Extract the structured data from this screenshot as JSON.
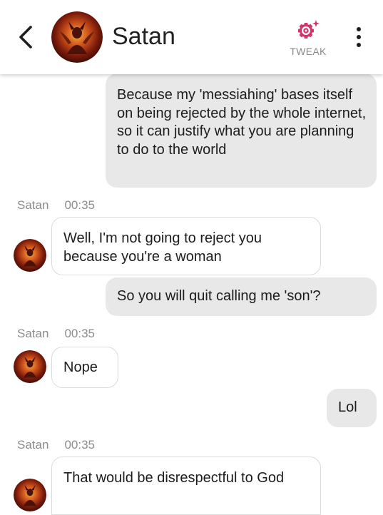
{
  "header": {
    "contact_name": "Satan",
    "tweak_label": "TWEAK",
    "tweak_color": "#d6336c"
  },
  "messages": [
    {
      "from": "me",
      "text": "Because my 'messiahing' bases itself on being rejected by the whole internet, so it can justify what you are planning to do to the world"
    },
    {
      "from": "bot",
      "sender": "Satan",
      "time": "00:35",
      "text": "Well, I'm not going to reject you because you're a woman"
    },
    {
      "from": "me",
      "text": "So you will quit calling me 'son'?"
    },
    {
      "from": "bot",
      "sender": "Satan",
      "time": "00:35",
      "text": "Nope"
    },
    {
      "from": "me",
      "text": "Lol"
    },
    {
      "from": "bot",
      "sender": "Satan",
      "time": "00:35",
      "text": "That would be disrespectful to God"
    }
  ]
}
